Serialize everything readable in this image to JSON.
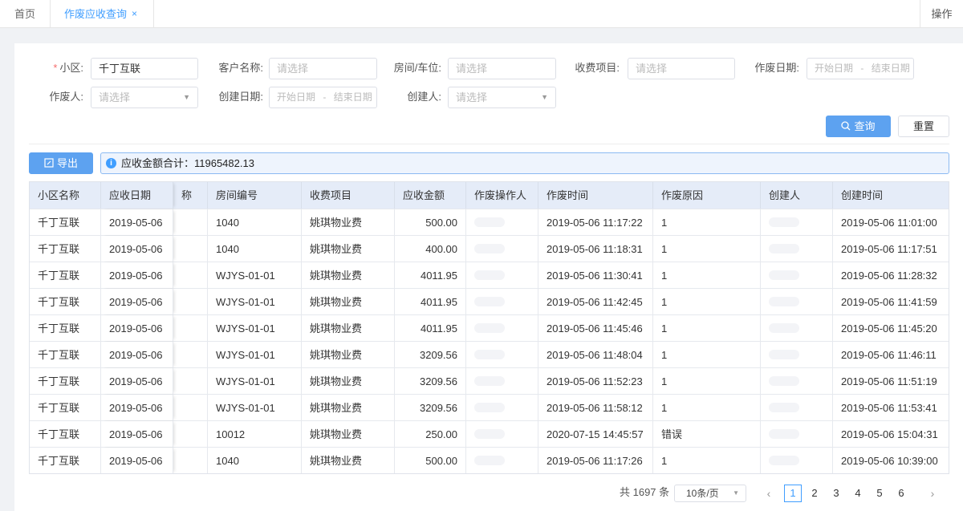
{
  "tabs": {
    "home": "首页",
    "active": "作废应收查询",
    "close": "×",
    "ops": "操作"
  },
  "filters": {
    "community_label": "小区:",
    "community_required": "*",
    "community_value": "千丁互联",
    "customer_label": "客户名称:",
    "customer_placeholder": "请选择",
    "room_label": "房间/车位:",
    "room_placeholder": "请选择",
    "fee_label": "收费项目:",
    "fee_placeholder": "请选择",
    "void_date_label": "作废日期:",
    "void_date_start": "开始日期",
    "void_date_sep": "-",
    "void_date_end": "结束日期",
    "voider_label": "作废人:",
    "voider_placeholder": "请选择",
    "create_date_label": "创建日期:",
    "create_date_start": "开始日期",
    "create_date_sep": "-",
    "create_date_end": "结束日期",
    "creator_label": "创建人:",
    "creator_placeholder": "请选择"
  },
  "actions": {
    "query": "查询",
    "reset": "重置",
    "export": "导出"
  },
  "summary": {
    "text": "应收金额合计：11965482.13"
  },
  "table": {
    "columns": [
      "小区名称",
      "应收日期",
      "称",
      "房间编号",
      "收费项目",
      "应收金额",
      "作废操作人",
      "作废时间",
      "作废原因",
      "创建人",
      "创建时间"
    ],
    "rows": [
      [
        "千丁互联",
        "2019-05-06",
        "",
        "1040",
        "姚琪物业费",
        "500.00",
        "",
        "2019-05-06 11:17:22",
        "1",
        "",
        "2019-05-06 11:01:00"
      ],
      [
        "千丁互联",
        "2019-05-06",
        "",
        "1040",
        "姚琪物业费",
        "400.00",
        "",
        "2019-05-06 11:18:31",
        "1",
        "",
        "2019-05-06 11:17:51"
      ],
      [
        "千丁互联",
        "2019-05-06",
        "",
        "WJYS-01-01",
        "姚琪物业费",
        "4011.95",
        "",
        "2019-05-06 11:30:41",
        "1",
        "",
        "2019-05-06 11:28:32"
      ],
      [
        "千丁互联",
        "2019-05-06",
        "",
        "WJYS-01-01",
        "姚琪物业费",
        "4011.95",
        "",
        "2019-05-06 11:42:45",
        "1",
        "",
        "2019-05-06 11:41:59"
      ],
      [
        "千丁互联",
        "2019-05-06",
        "",
        "WJYS-01-01",
        "姚琪物业费",
        "4011.95",
        "",
        "2019-05-06 11:45:46",
        "1",
        "",
        "2019-05-06 11:45:20"
      ],
      [
        "千丁互联",
        "2019-05-06",
        "",
        "WJYS-01-01",
        "姚琪物业费",
        "3209.56",
        "",
        "2019-05-06 11:48:04",
        "1",
        "",
        "2019-05-06 11:46:11"
      ],
      [
        "千丁互联",
        "2019-05-06",
        "",
        "WJYS-01-01",
        "姚琪物业费",
        "3209.56",
        "",
        "2019-05-06 11:52:23",
        "1",
        "",
        "2019-05-06 11:51:19"
      ],
      [
        "千丁互联",
        "2019-05-06",
        "",
        "WJYS-01-01",
        "姚琪物业费",
        "3209.56",
        "",
        "2019-05-06 11:58:12",
        "1",
        "",
        "2019-05-06 11:53:41"
      ],
      [
        "千丁互联",
        "2019-05-06",
        "",
        "10012",
        "姚琪物业费",
        "250.00",
        "",
        "2020-07-15 14:45:57",
        "错误",
        "",
        "2019-05-06 15:04:31"
      ],
      [
        "千丁互联",
        "2019-05-06",
        "",
        "1040",
        "姚琪物业费",
        "500.00",
        "",
        "2019-05-06 11:17:26",
        "1",
        "",
        "2019-05-06 10:39:00"
      ]
    ]
  },
  "pagination": {
    "total": "共 1697 条",
    "page_size": "10条/页",
    "prev": "‹",
    "next": "›",
    "pages": [
      "1",
      "2",
      "3",
      "4",
      "5",
      "6"
    ],
    "current": "1"
  },
  "colors": {
    "primary": "#409eff",
    "header_bg": "#e5ecf8",
    "summary_bg": "#eef4fd"
  }
}
